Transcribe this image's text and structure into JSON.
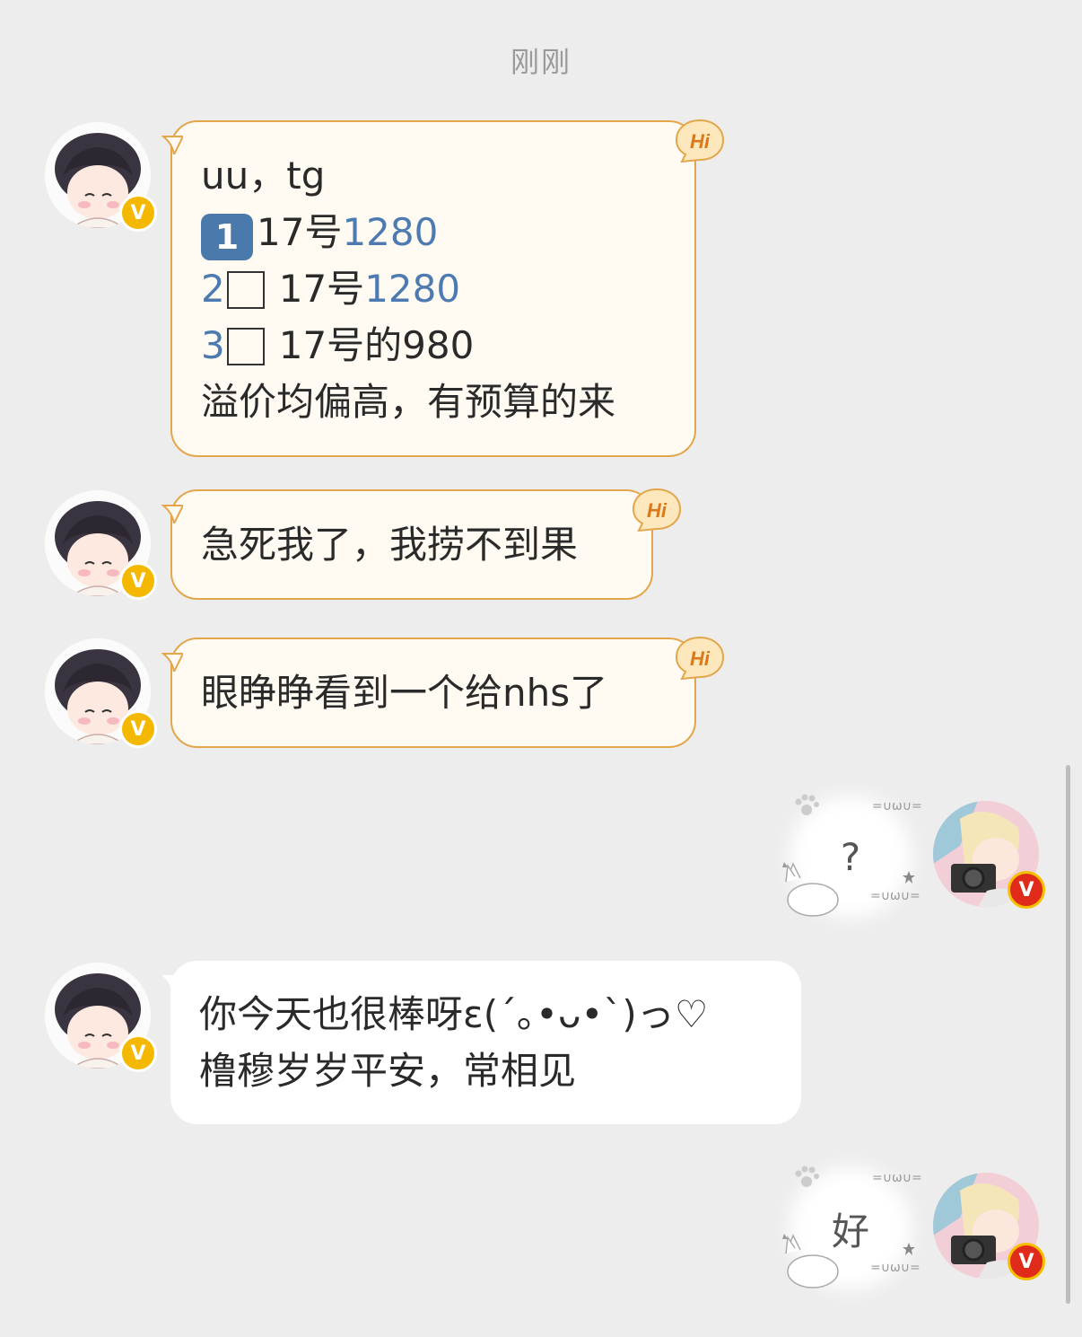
{
  "timestamp": "刚刚",
  "messages": [
    {
      "side": "left",
      "style": "hi",
      "lines": [
        {
          "parts": [
            {
              "t": "uu，tg"
            }
          ]
        },
        {
          "parts": [
            {
              "kbd": "1"
            },
            {
              "t": "17号"
            },
            {
              "n": "1280"
            }
          ]
        },
        {
          "parts": [
            {
              "n": "2"
            },
            {
              "box": true
            },
            {
              "t": "17号"
            },
            {
              "n": "1280"
            }
          ]
        },
        {
          "parts": [
            {
              "n": "3"
            },
            {
              "box": true
            },
            {
              "t": "17号的980"
            }
          ]
        },
        {
          "parts": [
            {
              "t": "溢价均偏高，有预算的来"
            }
          ]
        }
      ]
    },
    {
      "side": "left",
      "style": "hi",
      "lines": [
        {
          "parts": [
            {
              "t": "急死我了，我捞不到果"
            }
          ]
        }
      ]
    },
    {
      "side": "left",
      "style": "hi",
      "lines": [
        {
          "parts": [
            {
              "t": "眼睁睁看到一个给nhs了"
            }
          ]
        }
      ]
    },
    {
      "side": "right",
      "text": "?"
    },
    {
      "side": "left",
      "style": "plain",
      "lines": [
        {
          "parts": [
            {
              "t": "你今天也很棒呀ε(´｡•ᴗ•`)っ♡"
            }
          ]
        },
        {
          "parts": [
            {
              "t": "橹穆岁岁平安，常相见"
            }
          ]
        }
      ]
    },
    {
      "side": "right",
      "text": "好"
    }
  ],
  "badges": {
    "hi_label": "Hi",
    "verified_label": "V",
    "deco_face": "=∪ω∪="
  },
  "colors": {
    "background": "#ededed",
    "hi_border": "#e3a64a",
    "number_blue": "#4d7ab0",
    "gold_badge": "#f5b800",
    "red_badge": "#e02a1a"
  }
}
